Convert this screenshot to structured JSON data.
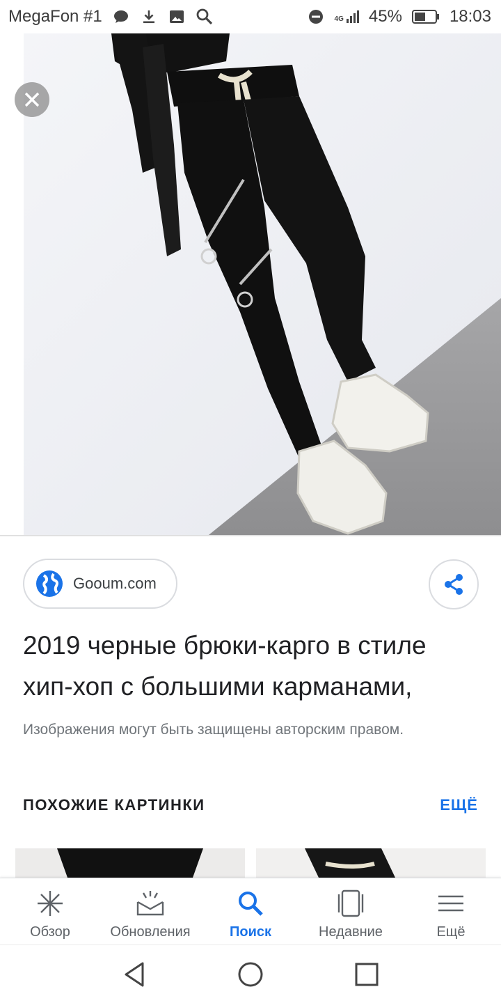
{
  "status_bar": {
    "carrier": "MegaFon #1",
    "network": "4G",
    "battery": "45%",
    "time": "18:03"
  },
  "hero": {
    "close_icon": "close-icon"
  },
  "result": {
    "source": "Gooum.com",
    "title": "2019 черные брюки-карго в стиле хип-хоп с большими карманами,",
    "copyright": "Изображения могут быть защищены авторским правом."
  },
  "similar": {
    "heading": "ПОХОЖИЕ КАРТИНКИ",
    "more": "ЕЩЁ"
  },
  "bottom_nav": {
    "items": [
      {
        "label": "Обзор",
        "icon": "asterisk-icon"
      },
      {
        "label": "Обновления",
        "icon": "tray-icon"
      },
      {
        "label": "Поиск",
        "icon": "search-icon"
      },
      {
        "label": "Недавние",
        "icon": "cards-icon"
      },
      {
        "label": "Ещё",
        "icon": "menu-icon"
      }
    ]
  },
  "colors": {
    "accent": "#1a73e8",
    "text": "#202124",
    "secondary": "#70757a"
  }
}
